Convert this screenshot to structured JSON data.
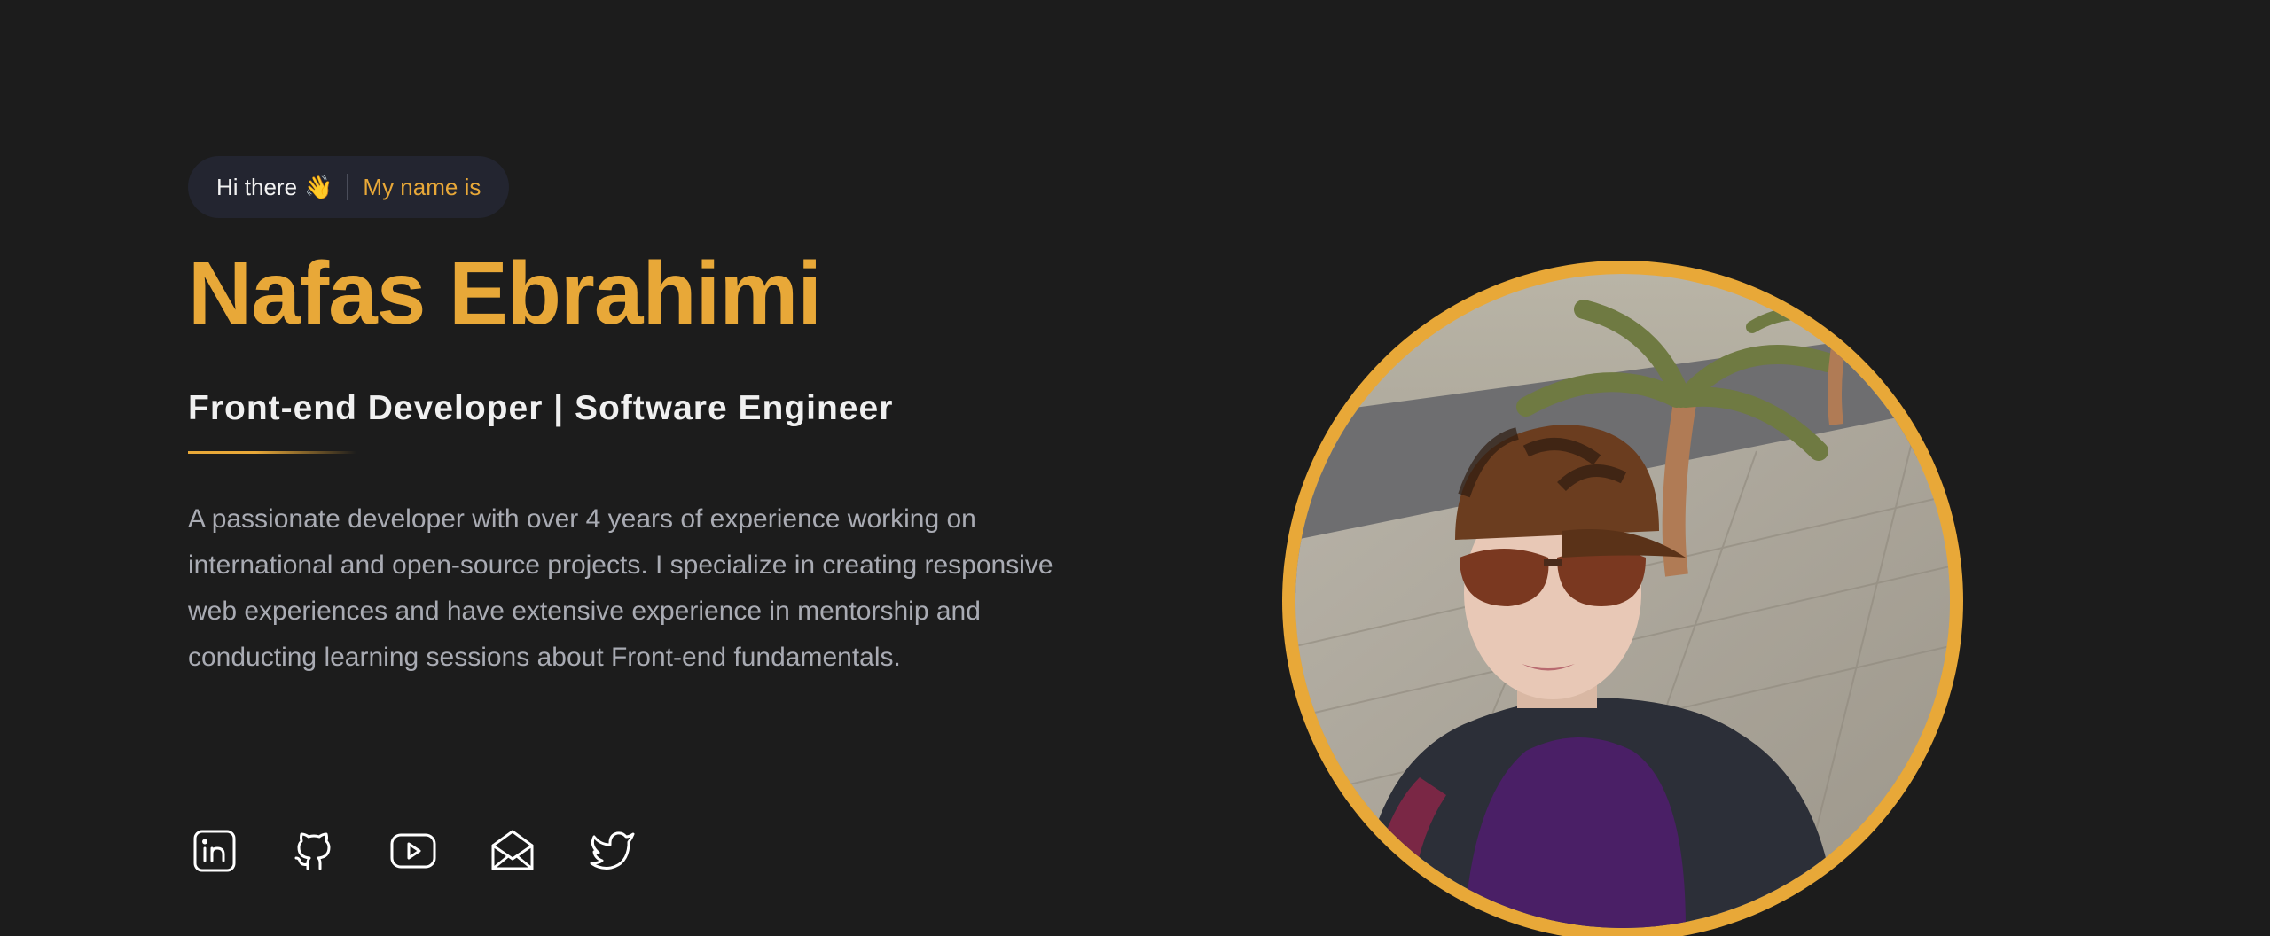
{
  "greeting": {
    "hi": "Hi there",
    "emoji": "👋",
    "intro": "My name is"
  },
  "name": "Nafas Ebrahimi",
  "role": "Front-end Developer | Software Engineer",
  "bio": "A passionate developer with over 4 years of experience working on international and open-source projects. I specialize in creating responsive web experiences and have extensive experience in mentorship and conducting learning sessions about Front-end fundamentals.",
  "socials": [
    {
      "icon": "linkedin-icon"
    },
    {
      "icon": "github-icon"
    },
    {
      "icon": "youtube-icon"
    },
    {
      "icon": "mail-icon"
    },
    {
      "icon": "twitter-icon"
    }
  ],
  "colors": {
    "background": "#1c1c1c",
    "accent": "#e8a838",
    "pill": "#232530",
    "body_text": "#a9abb3"
  }
}
